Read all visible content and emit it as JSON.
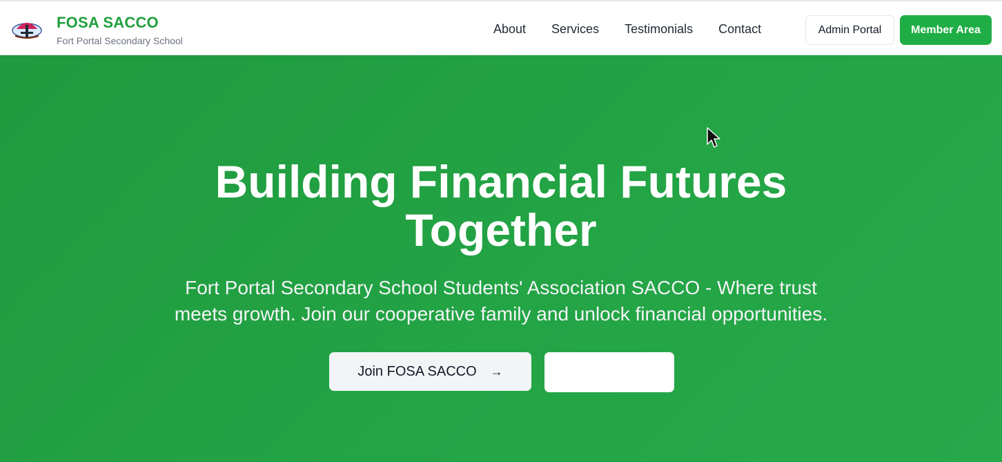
{
  "header": {
    "brand_name": "FOSA SACCO",
    "brand_sub": "Fort Portal Secondary School",
    "nav": [
      "About",
      "Services",
      "Testimonials",
      "Contact"
    ],
    "admin_label": "Admin Portal",
    "member_label": "Member Area"
  },
  "hero": {
    "title_line1": "Building Financial Futures",
    "title_line2": "Together",
    "subtitle_line1": "Fort Portal Secondary School Students' Association SACCO - Where trust",
    "subtitle_line2": "meets growth. Join our cooperative family and unlock financial opportunities.",
    "join_label": "Join FOSA SACCO",
    "join_arrow": "→",
    "secondary_label": ""
  },
  "colors": {
    "brand_green": "#1fa03d",
    "hero_bg": "#23a445",
    "member_button": "#1fae45"
  },
  "icons": {
    "logo": "school-crest-logo",
    "join_arrow": "arrow-right-icon",
    "cursor": "mouse-pointer-icon"
  }
}
